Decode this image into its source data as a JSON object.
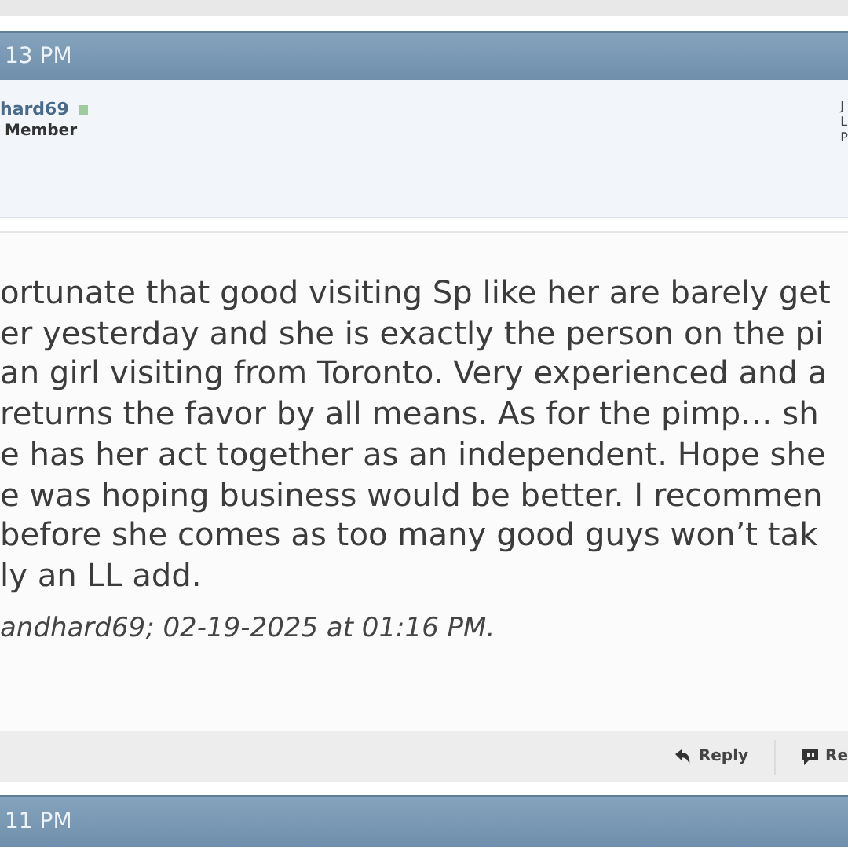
{
  "post_header": {
    "time": "13 PM"
  },
  "author": {
    "username": "hard69",
    "online": true,
    "rank": "Member",
    "details": [
      "J",
      "L",
      "P"
    ]
  },
  "post_body": {
    "lines": [
      "ortunate that good visiting Sp like her are barely get",
      "er yesterday and she is exactly the person on the pi",
      "an girl visiting from Toronto. Very experienced and a",
      "returns the favor by all means. As for the pimp… sh",
      "e has her act together as an independent. Hope she",
      "e was hoping business would be better. I recommen",
      "before she comes as too many good guys won’t tak",
      "ly an LL add."
    ],
    "edited_note": "andhard69; 02-19-2025 at 01:16 PM."
  },
  "post_footer": {
    "buttons": [
      {
        "kind": "reply",
        "label": "Reply"
      },
      {
        "kind": "report",
        "label": "Re"
      }
    ]
  },
  "next_post_header": {
    "time": "11 PM"
  }
}
